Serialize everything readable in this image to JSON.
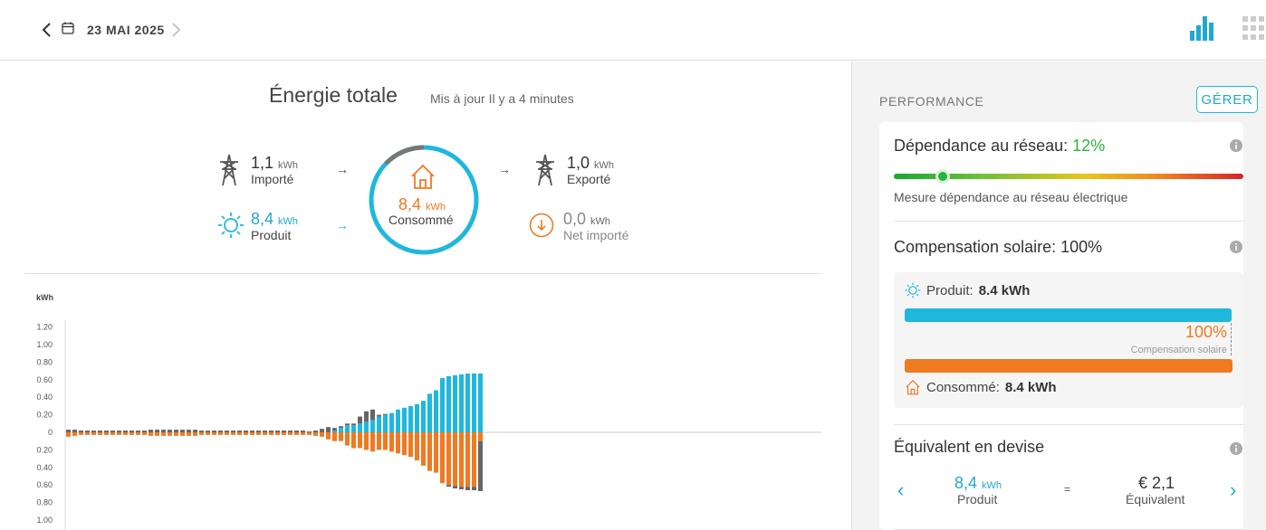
{
  "header": {
    "date": "23 MAI 2025"
  },
  "main": {
    "title": "Énergie totale",
    "subtitle": "Mis à jour Il y a 4 minutes",
    "imported": {
      "value": "1,1",
      "unit": "kWh",
      "label": "Importé"
    },
    "produced": {
      "value": "8,4",
      "unit": "kWh",
      "label": "Produit"
    },
    "consumed": {
      "value": "8,4",
      "unit": "kWh",
      "label": "Consommé"
    },
    "exported": {
      "value": "1,0",
      "unit": "kWh",
      "label": "Exporté"
    },
    "net_imported": {
      "value": "0,0",
      "unit": "kWh",
      "label": "Net importé"
    },
    "arrow": "→"
  },
  "chart_data": {
    "type": "bar",
    "ylabel": "kWh",
    "yticks_top": [
      "1.20",
      "1.00",
      "0.80",
      "0.60",
      "0.40",
      "0.20",
      "0"
    ],
    "yticks_bottom": [
      "0.20",
      "0.40",
      "0.60",
      "0.80",
      "1.00"
    ],
    "ylim": [
      -1.0,
      1.2
    ],
    "series": [
      {
        "name": "Produit",
        "color": "#1fb8dc",
        "values": [
          0,
          0,
          0,
          0,
          0,
          0,
          0,
          0,
          0,
          0,
          0,
          0,
          0,
          0,
          0,
          0,
          0,
          0,
          0,
          0,
          0,
          0,
          0,
          0,
          0,
          0,
          0,
          0,
          0,
          0,
          0,
          0,
          0,
          0,
          0,
          0,
          0,
          0,
          0,
          0,
          0,
          0,
          0.02,
          0.05,
          0.08,
          0.08,
          0.1,
          0.12,
          0.14,
          0.18,
          0.2,
          0.22,
          0.26,
          0.28,
          0.3,
          0.32,
          0.36,
          0.44,
          0.48,
          0.62,
          0.64,
          0.65,
          0.66,
          0.67,
          0.67,
          0.67
        ]
      },
      {
        "name": "Import",
        "color": "#666666",
        "values": [
          0.03,
          0.03,
          0.02,
          0.02,
          0.02,
          0.02,
          0.02,
          0.02,
          0.02,
          0.02,
          0.02,
          0.02,
          0.02,
          0.03,
          0.03,
          0.03,
          0.03,
          0.03,
          0.03,
          0.03,
          0.03,
          0.02,
          0.02,
          0.02,
          0.02,
          0.02,
          0.02,
          0.02,
          0.02,
          0.02,
          0.02,
          0.02,
          0.02,
          0.02,
          0.02,
          0.02,
          0.02,
          0.02,
          0.01,
          0.02,
          0.04,
          0.06,
          0.03,
          0.02,
          0.02,
          0.02,
          0.08,
          0.12,
          0.12,
          0.02,
          0.01,
          0,
          0,
          0,
          0,
          0,
          0,
          0,
          0,
          0,
          0,
          0,
          0,
          0,
          0,
          0
        ]
      },
      {
        "name": "Consommé",
        "color": "#ef7a22",
        "values": [
          -0.05,
          -0.04,
          -0.03,
          -0.03,
          -0.03,
          -0.03,
          -0.03,
          -0.03,
          -0.03,
          -0.03,
          -0.03,
          -0.03,
          -0.03,
          -0.04,
          -0.04,
          -0.04,
          -0.04,
          -0.04,
          -0.04,
          -0.04,
          -0.04,
          -0.03,
          -0.03,
          -0.03,
          -0.03,
          -0.03,
          -0.03,
          -0.03,
          -0.03,
          -0.03,
          -0.03,
          -0.03,
          -0.03,
          -0.03,
          -0.03,
          -0.03,
          -0.03,
          -0.03,
          -0.03,
          -0.04,
          -0.05,
          -0.08,
          -0.1,
          -0.1,
          -0.15,
          -0.18,
          -0.18,
          -0.2,
          -0.22,
          -0.2,
          -0.2,
          -0.22,
          -0.24,
          -0.26,
          -0.28,
          -0.32,
          -0.38,
          -0.44,
          -0.46,
          -0.58,
          -0.6,
          -0.61,
          -0.62,
          -0.62,
          -0.62,
          -0.1
        ]
      },
      {
        "name": "Exporté",
        "color": "#666666",
        "values": [
          0,
          0,
          0,
          0,
          0,
          0,
          0,
          0,
          0,
          0,
          0,
          0,
          0,
          0,
          0,
          0,
          0,
          0,
          0,
          0,
          0,
          0,
          0,
          0,
          0,
          0,
          0,
          0,
          0,
          0,
          0,
          0,
          0,
          0,
          0,
          0,
          0,
          0,
          0,
          0,
          0,
          0,
          0,
          0,
          0,
          0,
          0,
          0,
          0,
          0,
          0,
          0,
          0,
          0,
          0,
          0,
          0,
          0,
          0,
          0,
          -0.02,
          -0.03,
          -0.03,
          -0.04,
          -0.04,
          -0.57
        ]
      }
    ]
  },
  "sidebar": {
    "title": "PERFORMANCE",
    "manage_label": "GÉRER",
    "dependence": {
      "label": "Dépendance au réseau:",
      "value": "12%",
      "level": 0.12,
      "description": "Mesure dépendance au réseau électrique"
    },
    "compensation": {
      "label": "Compensation solaire: 100%",
      "produced_label": "Produit:",
      "produced_value": "8.4 kWh",
      "percent": "100%",
      "percent_label": "Compensation solaire",
      "consumed_label": "Consommé:",
      "consumed_value": "8.4 kWh"
    },
    "currency": {
      "label": "Équivalent en devise",
      "value": "8,4",
      "unit": "kWh",
      "value_label": "Produit",
      "equals": "=",
      "equiv_value": "€ 2,1",
      "equiv_label": "Équivalent"
    }
  },
  "colors": {
    "accent": "#1fb8dc",
    "orange": "#ef7a22",
    "green": "#2ab43e",
    "gray_ring": "#777777"
  }
}
